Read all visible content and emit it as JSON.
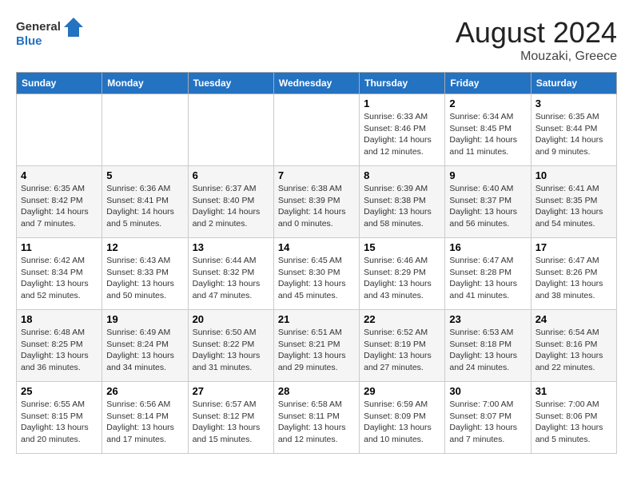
{
  "header": {
    "logo_line1": "General",
    "logo_line2": "Blue",
    "month_year": "August 2024",
    "location": "Mouzaki, Greece"
  },
  "days_of_week": [
    "Sunday",
    "Monday",
    "Tuesday",
    "Wednesday",
    "Thursday",
    "Friday",
    "Saturday"
  ],
  "weeks": [
    [
      {
        "day": "",
        "info": ""
      },
      {
        "day": "",
        "info": ""
      },
      {
        "day": "",
        "info": ""
      },
      {
        "day": "",
        "info": ""
      },
      {
        "day": "1",
        "info": "Sunrise: 6:33 AM\nSunset: 8:46 PM\nDaylight: 14 hours\nand 12 minutes."
      },
      {
        "day": "2",
        "info": "Sunrise: 6:34 AM\nSunset: 8:45 PM\nDaylight: 14 hours\nand 11 minutes."
      },
      {
        "day": "3",
        "info": "Sunrise: 6:35 AM\nSunset: 8:44 PM\nDaylight: 14 hours\nand 9 minutes."
      }
    ],
    [
      {
        "day": "4",
        "info": "Sunrise: 6:35 AM\nSunset: 8:42 PM\nDaylight: 14 hours\nand 7 minutes."
      },
      {
        "day": "5",
        "info": "Sunrise: 6:36 AM\nSunset: 8:41 PM\nDaylight: 14 hours\nand 5 minutes."
      },
      {
        "day": "6",
        "info": "Sunrise: 6:37 AM\nSunset: 8:40 PM\nDaylight: 14 hours\nand 2 minutes."
      },
      {
        "day": "7",
        "info": "Sunrise: 6:38 AM\nSunset: 8:39 PM\nDaylight: 14 hours\nand 0 minutes."
      },
      {
        "day": "8",
        "info": "Sunrise: 6:39 AM\nSunset: 8:38 PM\nDaylight: 13 hours\nand 58 minutes."
      },
      {
        "day": "9",
        "info": "Sunrise: 6:40 AM\nSunset: 8:37 PM\nDaylight: 13 hours\nand 56 minutes."
      },
      {
        "day": "10",
        "info": "Sunrise: 6:41 AM\nSunset: 8:35 PM\nDaylight: 13 hours\nand 54 minutes."
      }
    ],
    [
      {
        "day": "11",
        "info": "Sunrise: 6:42 AM\nSunset: 8:34 PM\nDaylight: 13 hours\nand 52 minutes."
      },
      {
        "day": "12",
        "info": "Sunrise: 6:43 AM\nSunset: 8:33 PM\nDaylight: 13 hours\nand 50 minutes."
      },
      {
        "day": "13",
        "info": "Sunrise: 6:44 AM\nSunset: 8:32 PM\nDaylight: 13 hours\nand 47 minutes."
      },
      {
        "day": "14",
        "info": "Sunrise: 6:45 AM\nSunset: 8:30 PM\nDaylight: 13 hours\nand 45 minutes."
      },
      {
        "day": "15",
        "info": "Sunrise: 6:46 AM\nSunset: 8:29 PM\nDaylight: 13 hours\nand 43 minutes."
      },
      {
        "day": "16",
        "info": "Sunrise: 6:47 AM\nSunset: 8:28 PM\nDaylight: 13 hours\nand 41 minutes."
      },
      {
        "day": "17",
        "info": "Sunrise: 6:47 AM\nSunset: 8:26 PM\nDaylight: 13 hours\nand 38 minutes."
      }
    ],
    [
      {
        "day": "18",
        "info": "Sunrise: 6:48 AM\nSunset: 8:25 PM\nDaylight: 13 hours\nand 36 minutes."
      },
      {
        "day": "19",
        "info": "Sunrise: 6:49 AM\nSunset: 8:24 PM\nDaylight: 13 hours\nand 34 minutes."
      },
      {
        "day": "20",
        "info": "Sunrise: 6:50 AM\nSunset: 8:22 PM\nDaylight: 13 hours\nand 31 minutes."
      },
      {
        "day": "21",
        "info": "Sunrise: 6:51 AM\nSunset: 8:21 PM\nDaylight: 13 hours\nand 29 minutes."
      },
      {
        "day": "22",
        "info": "Sunrise: 6:52 AM\nSunset: 8:19 PM\nDaylight: 13 hours\nand 27 minutes."
      },
      {
        "day": "23",
        "info": "Sunrise: 6:53 AM\nSunset: 8:18 PM\nDaylight: 13 hours\nand 24 minutes."
      },
      {
        "day": "24",
        "info": "Sunrise: 6:54 AM\nSunset: 8:16 PM\nDaylight: 13 hours\nand 22 minutes."
      }
    ],
    [
      {
        "day": "25",
        "info": "Sunrise: 6:55 AM\nSunset: 8:15 PM\nDaylight: 13 hours\nand 20 minutes."
      },
      {
        "day": "26",
        "info": "Sunrise: 6:56 AM\nSunset: 8:14 PM\nDaylight: 13 hours\nand 17 minutes."
      },
      {
        "day": "27",
        "info": "Sunrise: 6:57 AM\nSunset: 8:12 PM\nDaylight: 13 hours\nand 15 minutes."
      },
      {
        "day": "28",
        "info": "Sunrise: 6:58 AM\nSunset: 8:11 PM\nDaylight: 13 hours\nand 12 minutes."
      },
      {
        "day": "29",
        "info": "Sunrise: 6:59 AM\nSunset: 8:09 PM\nDaylight: 13 hours\nand 10 minutes."
      },
      {
        "day": "30",
        "info": "Sunrise: 7:00 AM\nSunset: 8:07 PM\nDaylight: 13 hours\nand 7 minutes."
      },
      {
        "day": "31",
        "info": "Sunrise: 7:00 AM\nSunset: 8:06 PM\nDaylight: 13 hours\nand 5 minutes."
      }
    ]
  ]
}
